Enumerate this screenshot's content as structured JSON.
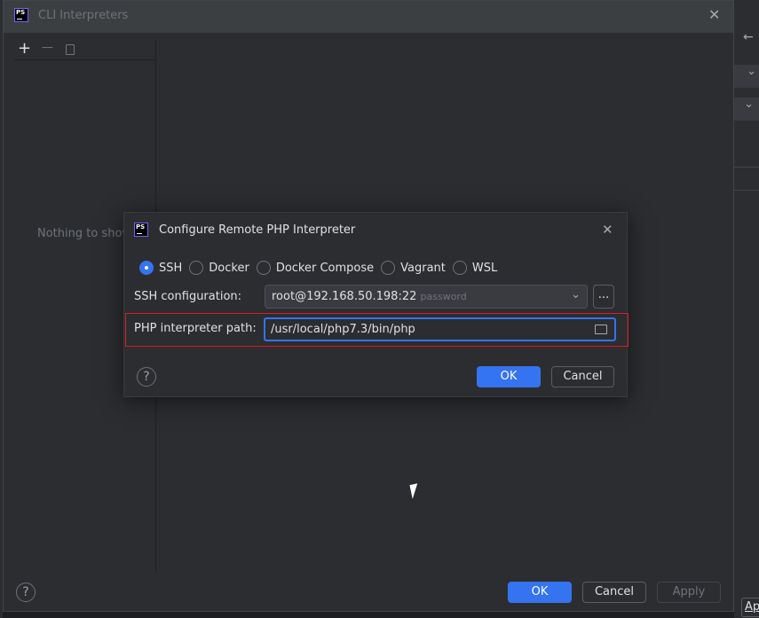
{
  "outer_dialog": {
    "title": "CLI Interpreters",
    "toolbar": {
      "add": "+",
      "remove": "—",
      "copy": "copy-icon"
    },
    "empty_text": "Nothing to show",
    "ok": "OK",
    "cancel": "Cancel",
    "apply": "Apply",
    "help": "?"
  },
  "inner_dialog": {
    "title": "Configure Remote PHP Interpreter",
    "options": [
      {
        "label": "SSH",
        "selected": true
      },
      {
        "label": "Docker",
        "selected": false
      },
      {
        "label": "Docker Compose",
        "selected": false
      },
      {
        "label": "Vagrant",
        "selected": false
      },
      {
        "label": "WSL",
        "selected": false
      }
    ],
    "ssh_label": "SSH configuration:",
    "ssh_value": "root@192.168.50.198:22",
    "ssh_hint": "password",
    "browse": "...",
    "path_label": "PHP interpreter path:",
    "path_value": "/usr/local/php7.3/bin/php",
    "ok": "OK",
    "cancel": "Cancel",
    "help": "?"
  },
  "background": {
    "apply_partial": "Ap"
  },
  "colors": {
    "accent": "#3574f0",
    "highlight": "#e01b24"
  }
}
